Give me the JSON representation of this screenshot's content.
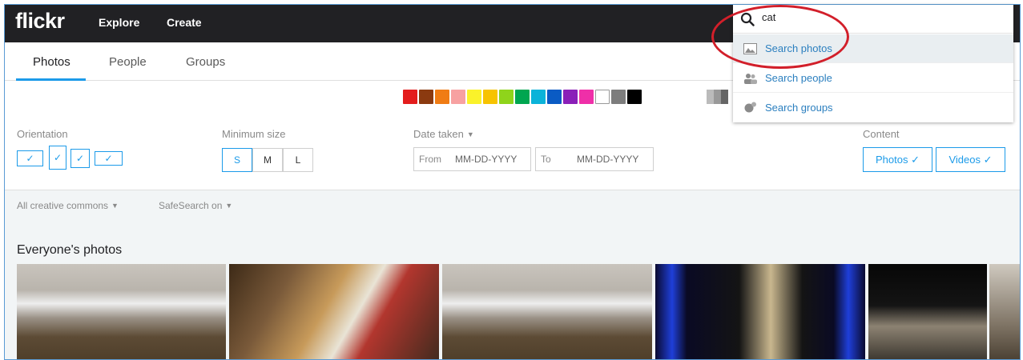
{
  "header": {
    "logo": "flickr",
    "nav": [
      {
        "label": "Explore"
      },
      {
        "label": "Create"
      }
    ]
  },
  "tabs": [
    {
      "label": "Photos",
      "active": true
    },
    {
      "label": "People"
    },
    {
      "label": "Groups"
    }
  ],
  "colors": {
    "accent": "#1c9be9",
    "swatches": [
      "#e31c1c",
      "#8b3a10",
      "#f07c14",
      "#f7a1a1",
      "#faf22a",
      "#f7c300",
      "#8fd41b",
      "#00a650",
      "#0bb3d9",
      "#0a5bc4",
      "#8a1fb8",
      "#ef2fa8",
      "#ffffff",
      "#7d7d7d",
      "#000000"
    ],
    "swatches_partial": [
      "#bbbbbb",
      "#999999",
      "#666666"
    ]
  },
  "filters": {
    "orientation_label": "Orientation",
    "orientation_check": "✓",
    "min_size_label": "Minimum size",
    "sizes": [
      "S",
      "M",
      "L"
    ],
    "date_label": "Date taken",
    "from_label": "From",
    "to_label": "To",
    "date_placeholder": "MM-DD-YYYY",
    "content_label": "Content",
    "content_photos": "Photos ✓",
    "content_videos": "Videos ✓"
  },
  "options": {
    "license": "All creative commons",
    "safesearch": "SafeSearch on"
  },
  "results": {
    "heading": "Everyone's photos"
  },
  "search": {
    "value": "cat",
    "suggestions": [
      {
        "label": "Search photos",
        "icon": "image-icon"
      },
      {
        "label": "Search people",
        "icon": "people-icon"
      },
      {
        "label": "Search groups",
        "icon": "groups-icon"
      }
    ]
  }
}
